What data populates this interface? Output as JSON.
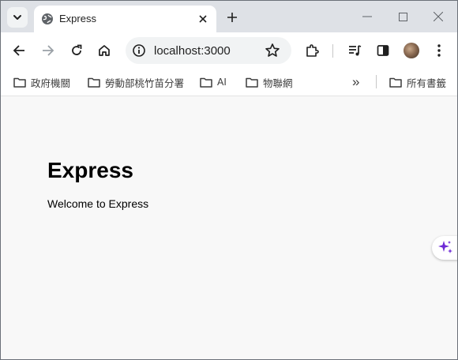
{
  "tab": {
    "title": "Express"
  },
  "omnibox": {
    "url": "localhost:3000"
  },
  "bookmarks": {
    "items": [
      {
        "label": "政府機關"
      },
      {
        "label": "勞動部桃竹苗分署"
      },
      {
        "label": "AI"
      },
      {
        "label": "物聯網"
      }
    ],
    "overflow_label": "»",
    "other_folder": "所有書籤"
  },
  "page": {
    "heading": "Express",
    "paragraph": "Welcome to Express"
  },
  "colors": {
    "frame": "#dee1e6",
    "tab_active": "#ffffff",
    "content_bg": "#f8f8f8",
    "sparkle": "#6e2ad6"
  },
  "icons": [
    "tab-search-icon",
    "globe-icon",
    "close-icon",
    "plus-icon",
    "minimize-icon",
    "maximize-icon",
    "window-close-icon",
    "back-arrow-icon",
    "forward-arrow-icon",
    "reload-icon",
    "home-icon",
    "site-info-icon",
    "star-icon",
    "extensions-icon",
    "media-control-icon",
    "side-panel-icon",
    "kebab-menu-icon",
    "folder-icon",
    "sparkle-icon"
  ]
}
